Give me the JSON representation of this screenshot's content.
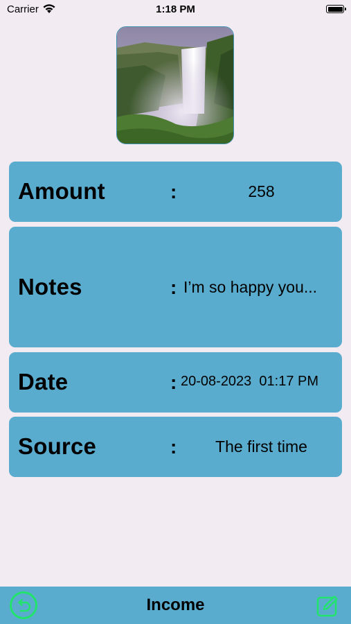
{
  "status_bar": {
    "carrier": "Carrier",
    "time": "1:18 PM"
  },
  "details": {
    "amount": {
      "label": "Amount",
      "separator": ":",
      "value": "258"
    },
    "notes": {
      "label": "Notes",
      "separator": ":",
      "value": "I’m so happy you..."
    },
    "date": {
      "label": "Date",
      "separator": ":",
      "value": "20-08-2023  01:17 PM"
    },
    "source": {
      "label": "Source",
      "separator": ":",
      "value": "The first time"
    }
  },
  "bottom_bar": {
    "title": "Income",
    "back_icon": "undo-circle-icon",
    "edit_icon": "edit-square-icon"
  },
  "colors": {
    "background": "#f2ebf1",
    "card": "#5aaccf",
    "accent_green": "#22e36b"
  }
}
